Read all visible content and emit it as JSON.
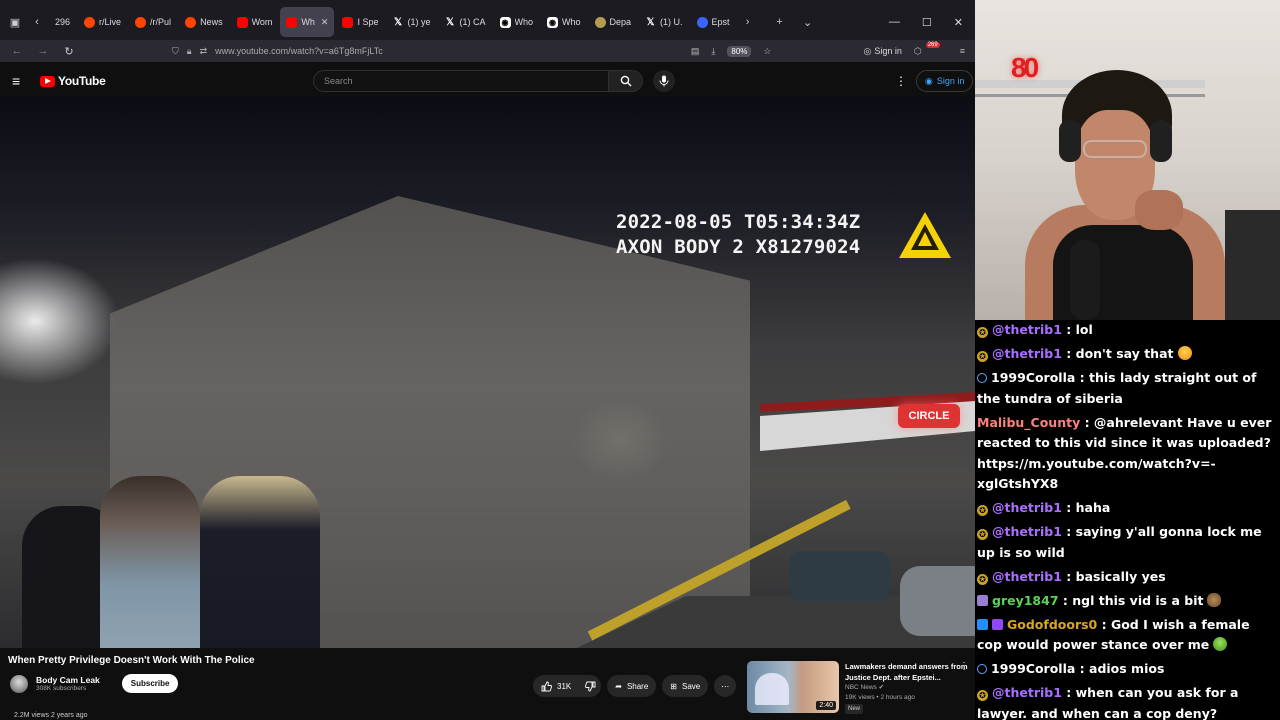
{
  "browser": {
    "tabs": [
      {
        "label": "296",
        "icon": "none",
        "active": false
      },
      {
        "label": "r/Live",
        "icon": "reddit",
        "active": false
      },
      {
        "label": "/r/Pul",
        "icon": "reddit",
        "active": false
      },
      {
        "label": "News",
        "icon": "reddit",
        "active": false
      },
      {
        "label": "Wom",
        "icon": "yt",
        "active": false
      },
      {
        "label": "Wh",
        "icon": "yt",
        "active": true
      },
      {
        "label": "I Spe",
        "icon": "yt",
        "active": false
      },
      {
        "label": "(1) ye",
        "icon": "x",
        "active": false
      },
      {
        "label": "(1) CA",
        "icon": "x",
        "active": false
      },
      {
        "label": "Who",
        "icon": "gh",
        "active": false
      },
      {
        "label": "Who",
        "icon": "gh",
        "active": false
      },
      {
        "label": "Depa",
        "icon": "dept",
        "active": false
      },
      {
        "label": "(1) U.",
        "icon": "x",
        "active": false
      },
      {
        "label": "Epst",
        "icon": "other",
        "active": false
      }
    ],
    "url": "www.youtube.com/watch?v=a6Tg8mFjLTc",
    "zoom": "80%",
    "signin": "Sign in",
    "notification_count": "269"
  },
  "youtube": {
    "logo": "YouTube",
    "search_placeholder": "Search",
    "signin": "Sign in",
    "video": {
      "timestamp": "2022-08-05 T05:34:34Z",
      "device": "AXON BODY 2 X81279024",
      "sign_text": "CIRCLE"
    },
    "title": "When Pretty Privilege Doesn't Work With The Police",
    "channel": "Body Cam Leak",
    "subscribers": "308K subscribers",
    "subscribe_label": "Subscribe",
    "views": "2.2M views  2 years ago",
    "likes": "31K",
    "share_label": "Share",
    "save_label": "Save",
    "recommended": {
      "title": "Lawmakers demand answers from Justice Dept. after Epstei...",
      "channel": "NBC News",
      "meta": "19K views • 2 hours ago",
      "badge": "New",
      "duration": "2:40"
    }
  },
  "webcam": {
    "light_text": "80"
  },
  "chat": {
    "messages": [
      {
        "badge": "sub",
        "user": "@thetrib1",
        "color": "#a970ff",
        "text": " : lol",
        "emote": ""
      },
      {
        "badge": "sub",
        "user": "@thetrib1",
        "color": "#a970ff",
        "text": " : don't say that",
        "emote": "laugh"
      },
      {
        "badge": "person",
        "user": "1999Corolla",
        "color": "#ffffff",
        "text": " : this lady straight out of the tundra of siberia",
        "emote": ""
      },
      {
        "badge": "",
        "user": "Malibu_County",
        "color": "#ff7f7f",
        "text": " : @ahrelevant Have u ever reacted to this vid since it was uploaded? https://m.youtube.com/watch?v=-xglGtshYX8",
        "emote": ""
      },
      {
        "badge": "sub",
        "user": "@thetrib1",
        "color": "#a970ff",
        "text": " : haha",
        "emote": ""
      },
      {
        "badge": "sub",
        "user": "@thetrib1",
        "color": "#a970ff",
        "text": " : saying y'all gonna lock me up is so wild",
        "emote": ""
      },
      {
        "badge": "sub",
        "user": "@thetrib1",
        "color": "#a970ff",
        "text": " : basically yes",
        "emote": ""
      },
      {
        "badge": "grid",
        "user": "grey1847",
        "color": "#57d357",
        "text": " : ngl this vid is a bit",
        "emote": "potato"
      },
      {
        "badge": "vipgem",
        "user": "Godofdoors0",
        "color": "#daa520",
        "text": " : God I wish a female cop would power stance over me",
        "emote": "green"
      },
      {
        "badge": "person",
        "user": "1999Corolla",
        "color": "#ffffff",
        "text": " : adios mios",
        "emote": ""
      },
      {
        "badge": "sub",
        "user": "@thetrib1",
        "color": "#a970ff",
        "text": " : when can you ask for a lawyer. and when can a cop deny?",
        "emote": ""
      }
    ]
  }
}
